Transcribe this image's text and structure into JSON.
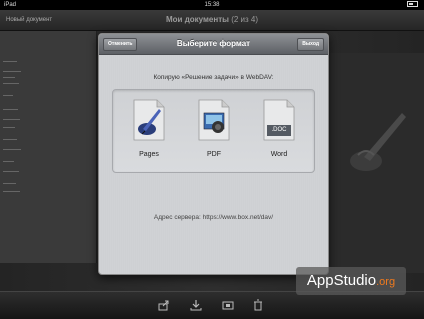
{
  "status_bar": {
    "carrier": "iPad",
    "time": "15:38",
    "battery": ""
  },
  "nav_bar": {
    "new_document": "Новый документ",
    "title": "Мои документы",
    "subtitle": "(2 из 4)"
  },
  "dialog": {
    "title": "Выберите формат",
    "cancel_label": "Отменить",
    "done_label": "Выход",
    "copy_text": "Копирую «Решение задачи» в WebDAV:",
    "formats": [
      {
        "label": "Pages",
        "icon": "pages-icon"
      },
      {
        "label": "PDF",
        "icon": "pdf-icon"
      },
      {
        "label": "Word",
        "icon": "word-icon",
        "badge": ".DOC"
      }
    ],
    "server_text": "Адрес сервера: https://www.box.net/dav/"
  },
  "toolbar": {
    "icons": [
      "share-icon",
      "download-icon",
      "copy-icon",
      "trash-icon"
    ]
  },
  "watermark": {
    "text": "AppStudio",
    "tld": ".org"
  },
  "colors": {
    "dialog_header": "#7b7e82",
    "background": "#1c1c1c",
    "watermark_accent": "#f07a1e"
  }
}
